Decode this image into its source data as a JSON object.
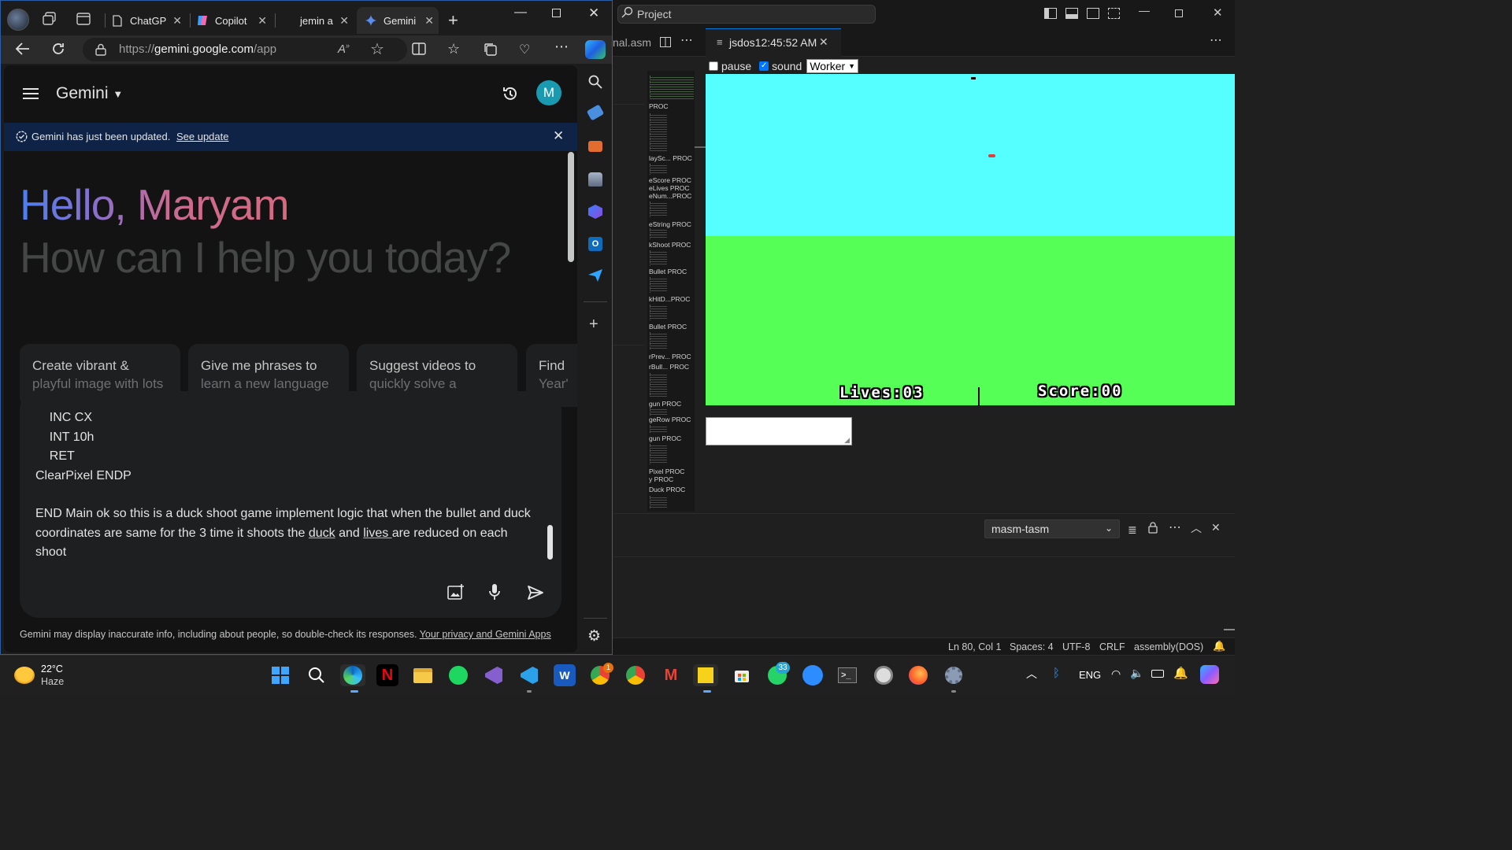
{
  "browser": {
    "tabs": [
      {
        "label": "ChatGP",
        "icon": "document-icon"
      },
      {
        "label": "Copilot",
        "icon": "copilot-icon"
      },
      {
        "label": "jemin a",
        "icon": "blank-icon"
      },
      {
        "label": "Gemini",
        "icon": "gemini-sparkle-icon",
        "active": true
      }
    ],
    "url_prefix": "https://",
    "url_host": "gemini.google.com",
    "url_path": "/app"
  },
  "gemini": {
    "brand": "Gemini",
    "avatar_letter": "M",
    "banner_text": "Gemini has just been updated.",
    "banner_link": "See update",
    "greeting": "Hello, Maryam",
    "subgreeting": "How can I help you today?",
    "suggestions": [
      {
        "line1": "Create vibrant &",
        "line2": "playful image with lots"
      },
      {
        "line1": "Give me phrases to",
        "line2": "learn a new language"
      },
      {
        "line1": "Suggest videos to",
        "line2": "quickly solve a"
      },
      {
        "line1": "Find",
        "line2": "Year'"
      }
    ],
    "code_lines": [
      "    INC CX",
      "    INT 10h",
      "    RET",
      "ClearPixel ENDP"
    ],
    "prompt_before": "END Main ok so this is a duck shoot game implement logic that when the bullet and duck coordinates are same for the 3 time it shoots the ",
    "prompt_word1": "duck",
    "prompt_mid": " and ",
    "prompt_word2": "lives ",
    "prompt_after": " are reduced on each shoot",
    "disclaimer": "Gemini may display inaccurate info, including about people, so double-check its responses.",
    "disclaimer_link": "Your privacy and Gemini Apps"
  },
  "vscode": {
    "search": "Project",
    "left_tab_fragment": "nal.asm",
    "jsdos_tab": "jsdos12:45:52 AM",
    "minimap_labels": [
      "PROC",
      "laySc... PROC",
      "eScore PROC",
      "eLives PROC",
      "eNum...PROC",
      "eString PROC",
      "kShoot PROC",
      "Bullet PROC",
      "kHitD...PROC",
      "Bullet PROC",
      "rPrev... PROC",
      "rBull... PROC",
      "gun PROC",
      "geRow PROC",
      "gun PROC",
      "Pixel PROC",
      "y PROC",
      "Duck PROC"
    ],
    "pause_label": "pause",
    "sound_label": "sound",
    "pause_checked": false,
    "sound_checked": true,
    "worker_option": "Worker",
    "game": {
      "lives_text": "Lives:03",
      "score_text": "Score:00",
      "sky_color": "#55ffff",
      "grass_color": "#55ff55"
    },
    "terminal_select": "masm-tasm",
    "status": {
      "position": "Ln 80, Col 1",
      "spaces": "Spaces: 4",
      "encoding": "UTF-8",
      "eol": "CRLF",
      "language": "assembly(DOS)"
    }
  },
  "taskbar": {
    "temperature": "22°C",
    "condition": "Haze",
    "whatsapp_badge": "33",
    "chrome_badge": "1",
    "language": "ENG",
    "apps": [
      "start-icon",
      "search-icon",
      "edge-icon",
      "netflix-icon",
      "file-explorer-icon",
      "spotify-icon",
      "visual-studio-icon",
      "vscode-icon",
      "word-icon",
      "chrome-icon",
      "chrome-profile-icon",
      "gmail-icon",
      "sticky-notes-icon",
      "microsoft-store-icon",
      "whatsapp-icon",
      "zoom-icon",
      "terminal-icon",
      "clock-icon",
      "firefox-icon",
      "settings-icon"
    ]
  }
}
